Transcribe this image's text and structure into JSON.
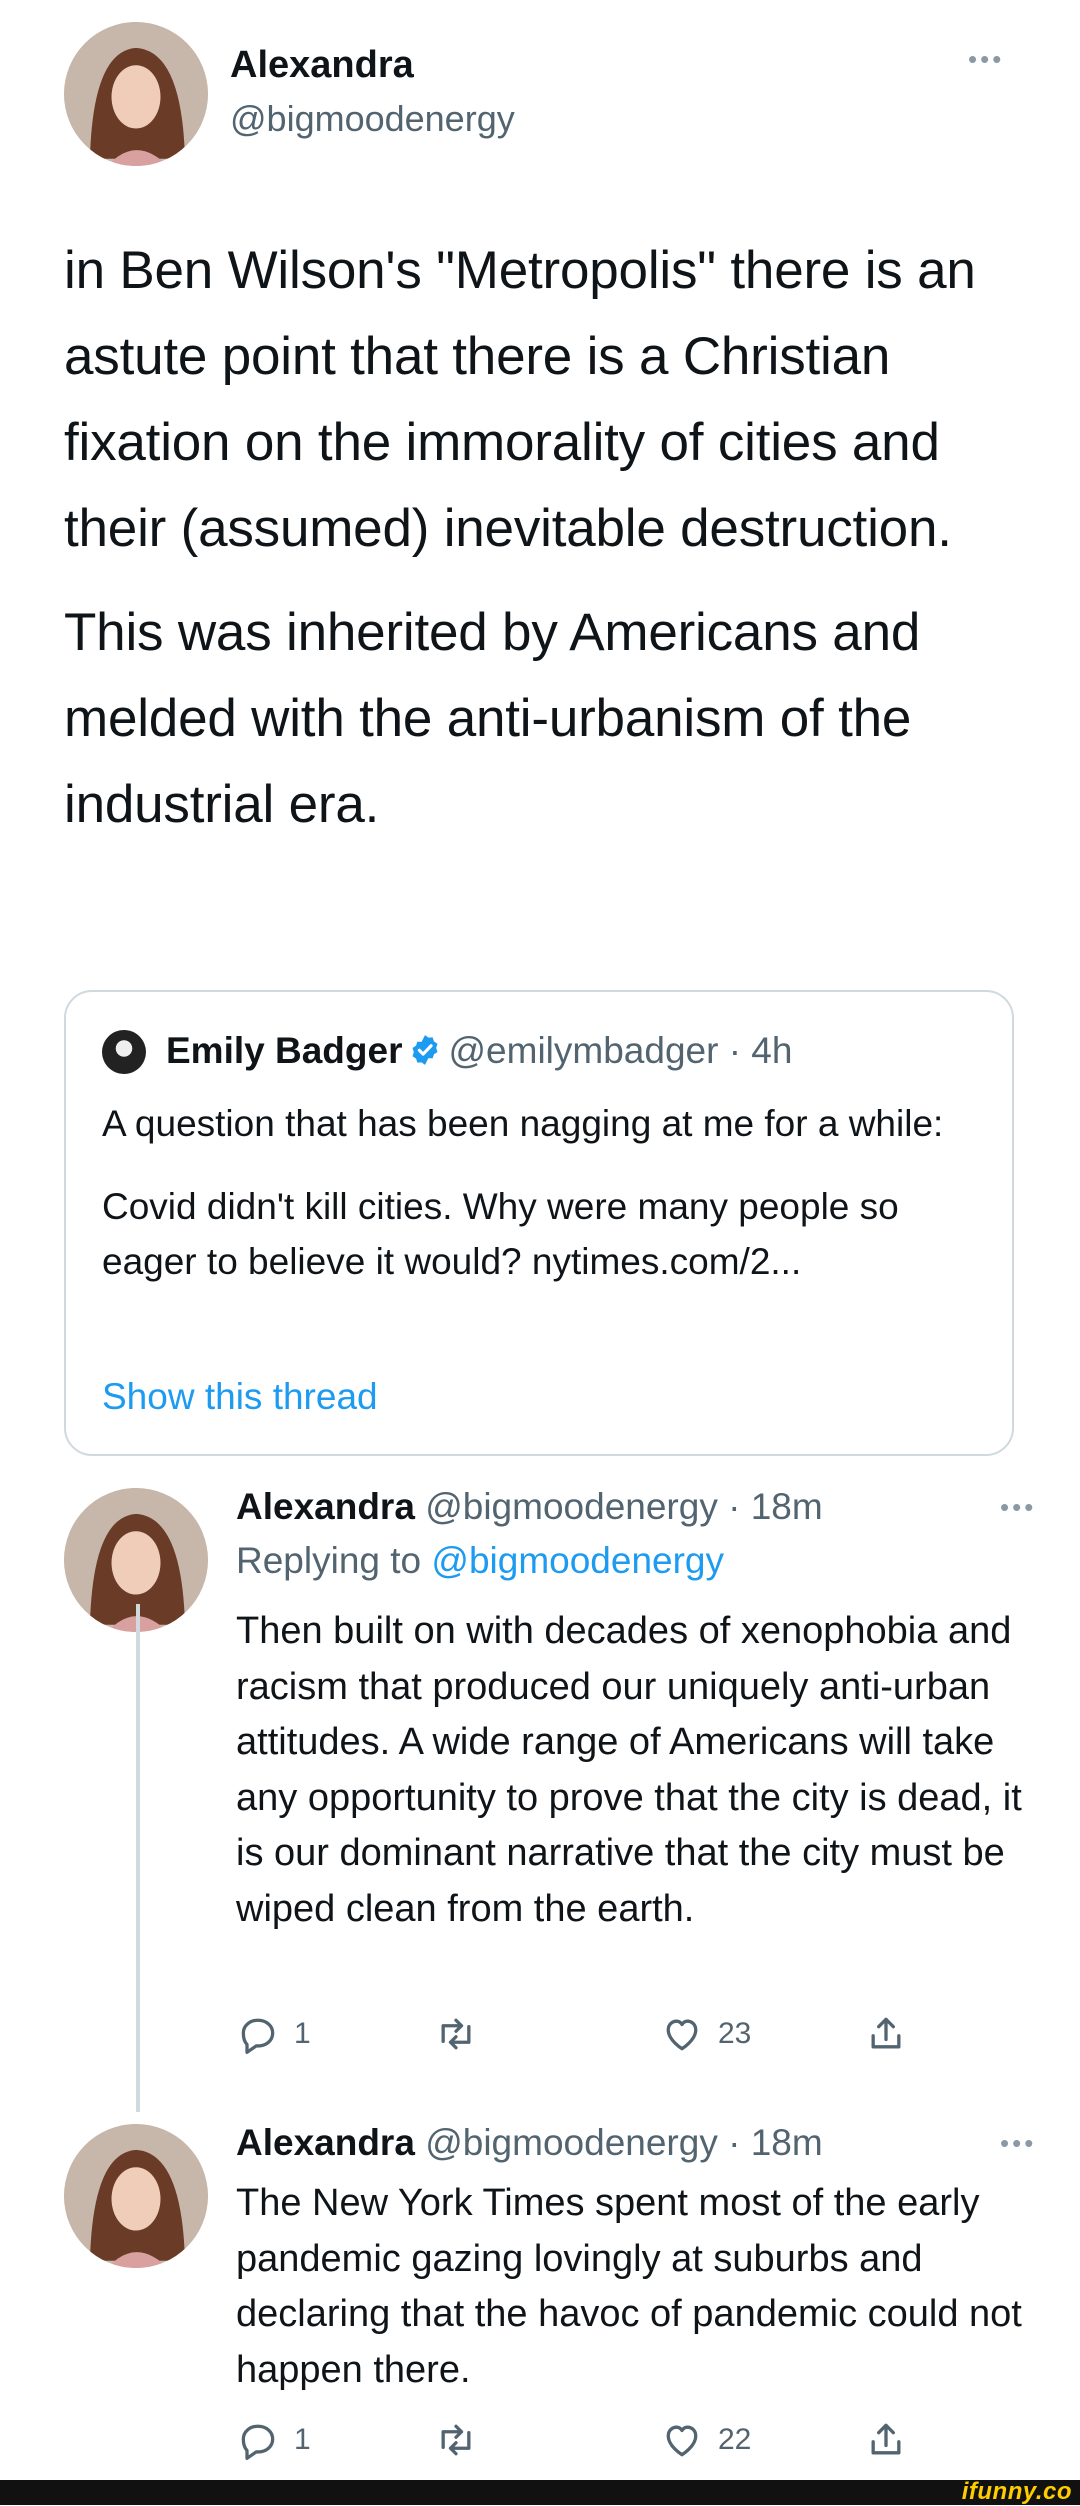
{
  "tweet": {
    "display_name": "Alexandra",
    "handle": "@bigmoodenergy",
    "more": "•••",
    "paragraphs": [
      "in Ben Wilson's \"Metropolis\" there is an astute point that there is a Christian fixation on the immorality of cities and their (assumed) inevitable destruction.",
      "This was inherited by Americans and melded with the anti-urbanism of the industrial era."
    ]
  },
  "quote": {
    "display_name": "Emily Badger",
    "handle": "@emilymbadger",
    "time": "· 4h",
    "paragraphs": [
      "A question that has been nagging at me for a while:",
      "Covid didn't kill cities. Why were many people so eager to believe it would? nytimes.com/2..."
    ],
    "show_thread": "Show this thread"
  },
  "replies": [
    {
      "display_name": "Alexandra",
      "handle": "@bigmoodenergy",
      "time": "· 18m",
      "more": "•••",
      "replying_prefix": "Replying to ",
      "replying_handle": "@bigmoodenergy",
      "text": "Then built on with decades of xenophobia and racism that produced our uniquely anti-urban attitudes. A wide range of Americans will take any opportunity to prove that the city is dead, it is our dominant narrative that the city must be wiped clean from the earth.",
      "reply_count": "1",
      "like_count": "23"
    },
    {
      "display_name": "Alexandra",
      "handle": "@bigmoodenergy",
      "time": "· 18m",
      "more": "•••",
      "text": "The New York Times spent most of the early pandemic gazing lovingly at suburbs and declaring that the havoc of pandemic could not happen there.",
      "reply_count": "1",
      "like_count": "22"
    }
  ],
  "watermark": "ifunny.co",
  "colors": {
    "link": "#1d9bf0",
    "secondary_text": "#536471",
    "border": "#cfd9de"
  }
}
